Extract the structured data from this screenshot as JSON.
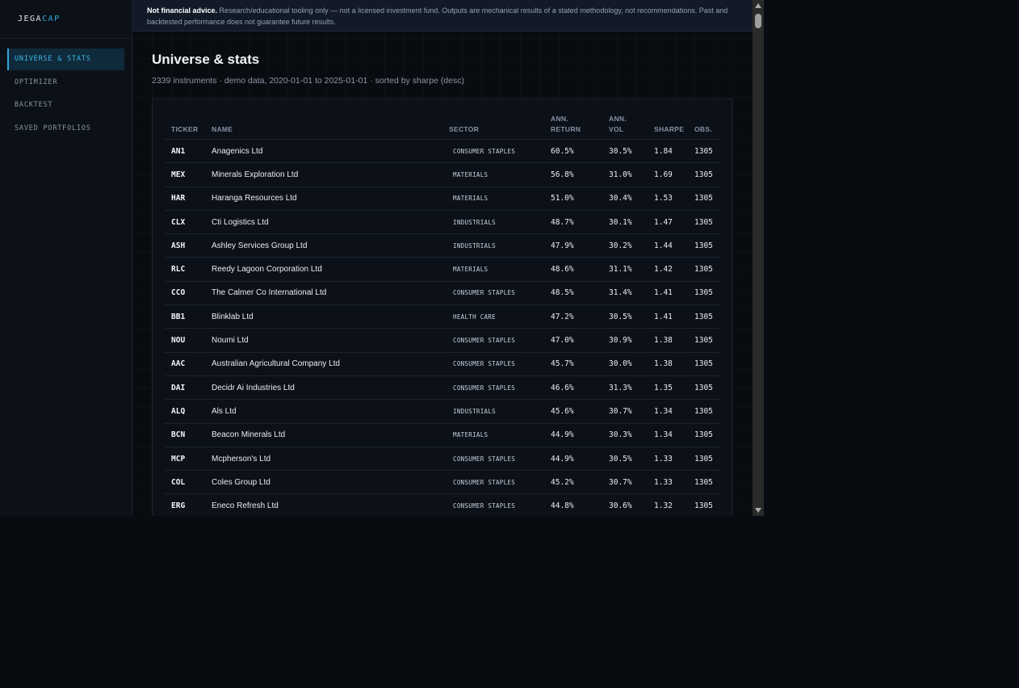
{
  "brand": {
    "part1": "JEGA",
    "part2": "CAP"
  },
  "nav": {
    "items": [
      {
        "label": "UNIVERSE & STATS"
      },
      {
        "label": "OPTIMIZER"
      },
      {
        "label": "BACKTEST"
      },
      {
        "label": "SAVED PORTFOLIOS"
      }
    ]
  },
  "disclaimer": {
    "strong": "Not financial advice.",
    "text": "Research/educational tooling only — not a licensed investment fund. Outputs are mechanical results of a stated methodology, not recommendations. Past and backtested performance does not guarantee future results."
  },
  "page": {
    "title": "Universe & stats",
    "subtitle": "2339 instruments · demo data, 2020-01-01 to 2025-01-01 · sorted by sharpe (desc)"
  },
  "table": {
    "headers": {
      "ticker": "TICKER",
      "name": "NAME",
      "sector": "SECTOR",
      "ann_return_1": "ANN.",
      "ann_return_2": "RETURN",
      "ann_vol_1": "ANN.",
      "ann_vol_2": "VOL",
      "sharpe": "SHARPE",
      "obs": "OBS."
    },
    "rows": [
      {
        "ticker": "AN1",
        "name": "Anagenics Ltd",
        "sector": "CONSUMER STAPLES",
        "ret": "60.5%",
        "vol": "30.5%",
        "sharpe": "1.84",
        "obs": "1305"
      },
      {
        "ticker": "MEX",
        "name": "Minerals Exploration Ltd",
        "sector": "MATERIALS",
        "ret": "56.8%",
        "vol": "31.0%",
        "sharpe": "1.69",
        "obs": "1305"
      },
      {
        "ticker": "HAR",
        "name": "Haranga Resources Ltd",
        "sector": "MATERIALS",
        "ret": "51.0%",
        "vol": "30.4%",
        "sharpe": "1.53",
        "obs": "1305"
      },
      {
        "ticker": "CLX",
        "name": "Cti Logistics Ltd",
        "sector": "INDUSTRIALS",
        "ret": "48.7%",
        "vol": "30.1%",
        "sharpe": "1.47",
        "obs": "1305"
      },
      {
        "ticker": "ASH",
        "name": "Ashley Services Group Ltd",
        "sector": "INDUSTRIALS",
        "ret": "47.9%",
        "vol": "30.2%",
        "sharpe": "1.44",
        "obs": "1305"
      },
      {
        "ticker": "RLC",
        "name": "Reedy Lagoon Corporation Ltd",
        "sector": "MATERIALS",
        "ret": "48.6%",
        "vol": "31.1%",
        "sharpe": "1.42",
        "obs": "1305"
      },
      {
        "ticker": "CCO",
        "name": "The Calmer Co International Ltd",
        "sector": "CONSUMER STAPLES",
        "ret": "48.5%",
        "vol": "31.4%",
        "sharpe": "1.41",
        "obs": "1305"
      },
      {
        "ticker": "BB1",
        "name": "Blinklab Ltd",
        "sector": "HEALTH CARE",
        "ret": "47.2%",
        "vol": "30.5%",
        "sharpe": "1.41",
        "obs": "1305"
      },
      {
        "ticker": "NOU",
        "name": "Noumi Ltd",
        "sector": "CONSUMER STAPLES",
        "ret": "47.0%",
        "vol": "30.9%",
        "sharpe": "1.38",
        "obs": "1305"
      },
      {
        "ticker": "AAC",
        "name": "Australian Agricultural Company Ltd",
        "sector": "CONSUMER STAPLES",
        "ret": "45.7%",
        "vol": "30.0%",
        "sharpe": "1.38",
        "obs": "1305"
      },
      {
        "ticker": "DAI",
        "name": "Decidr Ai Industries Ltd",
        "sector": "CONSUMER STAPLES",
        "ret": "46.6%",
        "vol": "31.3%",
        "sharpe": "1.35",
        "obs": "1305"
      },
      {
        "ticker": "ALQ",
        "name": "Als Ltd",
        "sector": "INDUSTRIALS",
        "ret": "45.6%",
        "vol": "30.7%",
        "sharpe": "1.34",
        "obs": "1305"
      },
      {
        "ticker": "BCN",
        "name": "Beacon Minerals Ltd",
        "sector": "MATERIALS",
        "ret": "44.9%",
        "vol": "30.3%",
        "sharpe": "1.34",
        "obs": "1305"
      },
      {
        "ticker": "MCP",
        "name": "Mcpherson's Ltd",
        "sector": "CONSUMER STAPLES",
        "ret": "44.9%",
        "vol": "30.5%",
        "sharpe": "1.33",
        "obs": "1305"
      },
      {
        "ticker": "COL",
        "name": "Coles Group Ltd",
        "sector": "CONSUMER STAPLES",
        "ret": "45.2%",
        "vol": "30.7%",
        "sharpe": "1.33",
        "obs": "1305"
      },
      {
        "ticker": "ERG",
        "name": "Eneco Refresh Ltd",
        "sector": "CONSUMER STAPLES",
        "ret": "44.8%",
        "vol": "30.6%",
        "sharpe": "1.32",
        "obs": "1305"
      }
    ]
  },
  "colors": {
    "background": "#080b10",
    "sidebar": "#0c1118",
    "accent": "#2fa9dc",
    "disclaimer_bg": "#121a28"
  }
}
